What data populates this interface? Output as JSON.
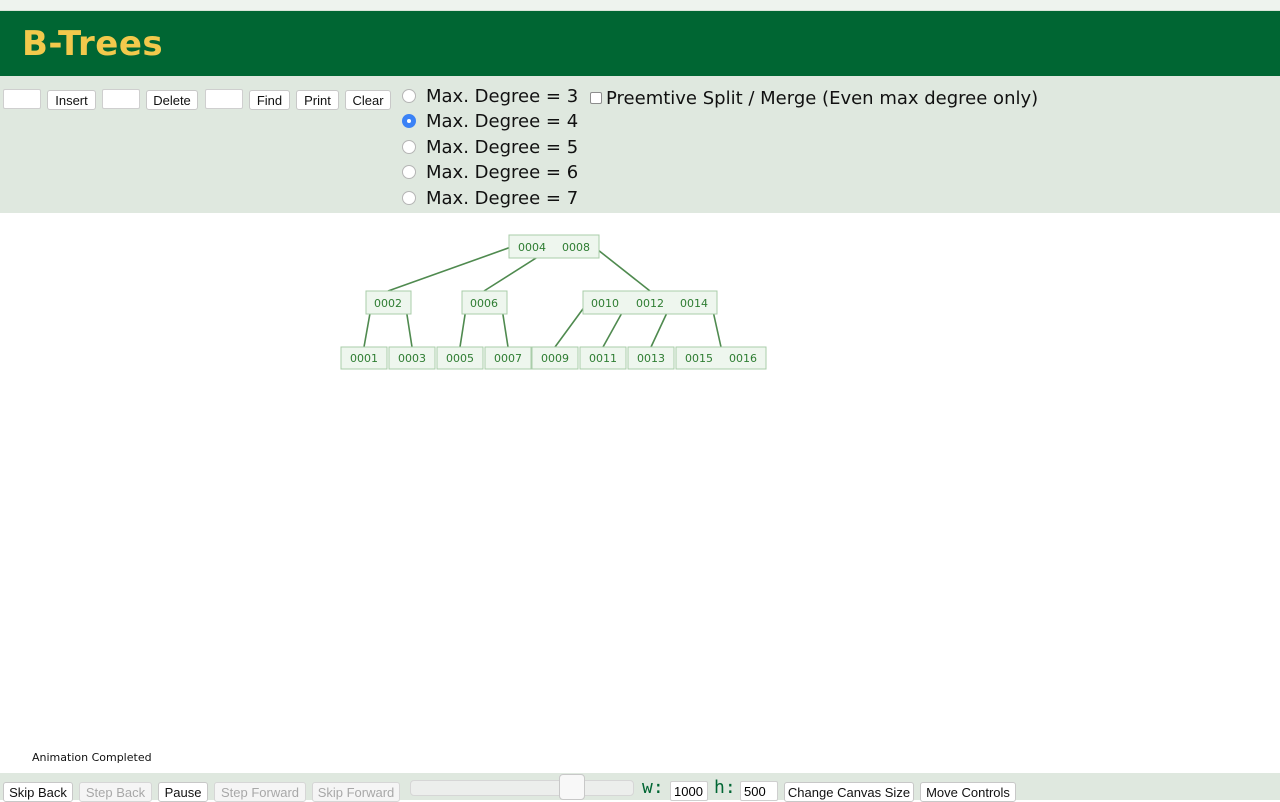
{
  "header": {
    "title": "B-Trees"
  },
  "controls": {
    "insert_label": "Insert",
    "delete_label": "Delete",
    "find_label": "Find",
    "print_label": "Print",
    "clear_label": "Clear",
    "insert_value": "",
    "delete_value": "",
    "find_value": "",
    "degree_options": [
      "Max. Degree = 3",
      "Max. Degree = 4",
      "Max. Degree = 5",
      "Max. Degree = 6",
      "Max. Degree = 7"
    ],
    "selected_degree": "Max. Degree = 4",
    "preemptive_label": "Preemtive Split / Merge (Even max degree only)",
    "preemptive_checked": false
  },
  "tree": {
    "root": [
      "0004",
      "0008"
    ],
    "level1": [
      [
        "0002"
      ],
      [
        "0006"
      ],
      [
        "0010",
        "0012",
        "0014"
      ]
    ],
    "leaves": [
      [
        "0001"
      ],
      [
        "0003"
      ],
      [
        "0005"
      ],
      [
        "0007"
      ],
      [
        "0009"
      ],
      [
        "0011"
      ],
      [
        "0013"
      ],
      [
        "0015",
        "0016"
      ]
    ],
    "accent": "#2e7d32"
  },
  "status": "Animation Completed",
  "bottom": {
    "skip_back": "Skip Back",
    "step_back": "Step Back",
    "pause": "Pause",
    "step_forward": "Step Forward",
    "skip_forward": "Skip Forward",
    "speed_fraction": 0.75,
    "w_label": "w:",
    "w_value": "1000",
    "h_label": "h:",
    "h_value": "500",
    "change_size": "Change Canvas Size",
    "move_controls": "Move Controls"
  }
}
